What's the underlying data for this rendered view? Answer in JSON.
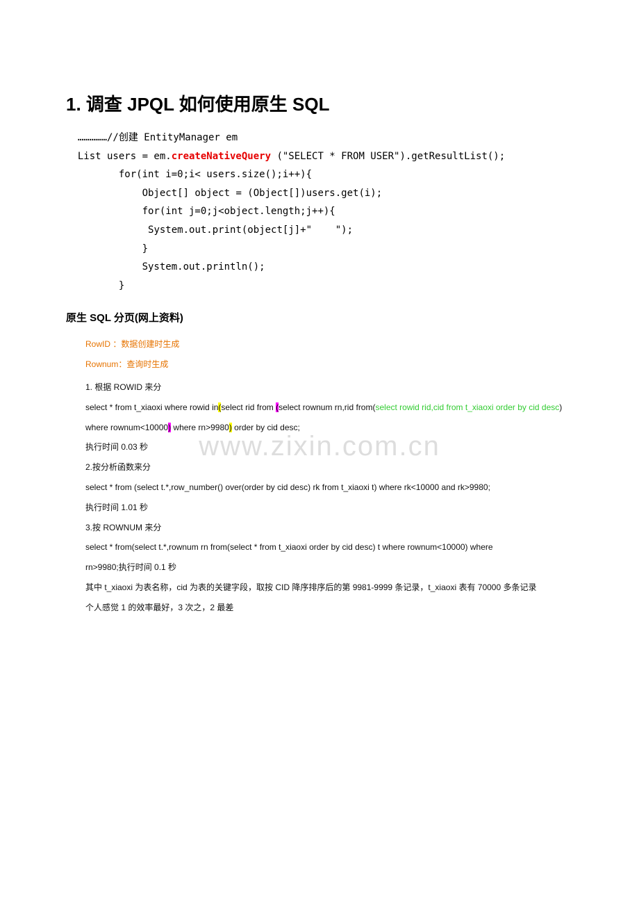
{
  "watermark": "www.zixin.com.cn",
  "heading1": "1. 调查 JPQL 如何使用原生 SQL",
  "code": {
    "line1": "  ……………//创建 EntityManager em",
    "line2a": "  List users = em.",
    "line2b": "createNativeQuery",
    "line2c": " (\"SELECT * FROM USER\").getResultList();",
    "line3": "         for(int i=0;i< users.size();i++){",
    "line4": "             Object[] object = (Object[])users.get(i);",
    "line5": "             for(int j=0;j<object.length;j++){",
    "line6": "              System.out.print(object[j]+\"    \");",
    "line7": "             }",
    "line8": "             System.out.println();",
    "line9": "         }"
  },
  "heading2": "原生 SQL 分页(网上资料)",
  "content": {
    "orange1": "RowID ：数据创建时生成",
    "orange2": "Rownum：查询时生成",
    "li1": "1.   根据 ROWID 来分",
    "sql1_a": "select * from t_xiaoxi where rowid in",
    "sql1_b": "(",
    "sql1_c": "select rid from ",
    "sql1_d": "(",
    "sql1_e": "select rownum rn,rid from(",
    "sql1_green": "select rowid rid,cid from t_xiaoxi  order by cid desc",
    "sql1_f": ") where rownum<10000",
    "sql1_g": ")",
    "sql1_h": " where rn>9980",
    "sql1_i": ")",
    "sql1_j": " order by cid desc;",
    "exec1": "执行时间 0.03 秒",
    "li2": "2.按分析函数来分",
    "sql2": "select * from (select t.*,row_number() over(order by cid desc) rk from t_xiaoxi t) where rk<10000 and rk>9980;",
    "exec2": "执行时间 1.01 秒",
    "li3": "3.按 ROWNUM 来分",
    "sql3": "select * from(select t.*,rownum rn from(select * from t_xiaoxi order by cid desc) t where rownum<10000) where",
    "sql3b": "rn>9980;执行时间 0.1 秒",
    "note1": "其中 t_xiaoxi 为表名称，cid 为表的关键字段，取按 CID 降序排序后的第 9981-9999 条记录，t_xiaoxi 表有 70000 多条记录",
    "note2": "个人感觉 1 的效率最好，3 次之，2 最差"
  }
}
